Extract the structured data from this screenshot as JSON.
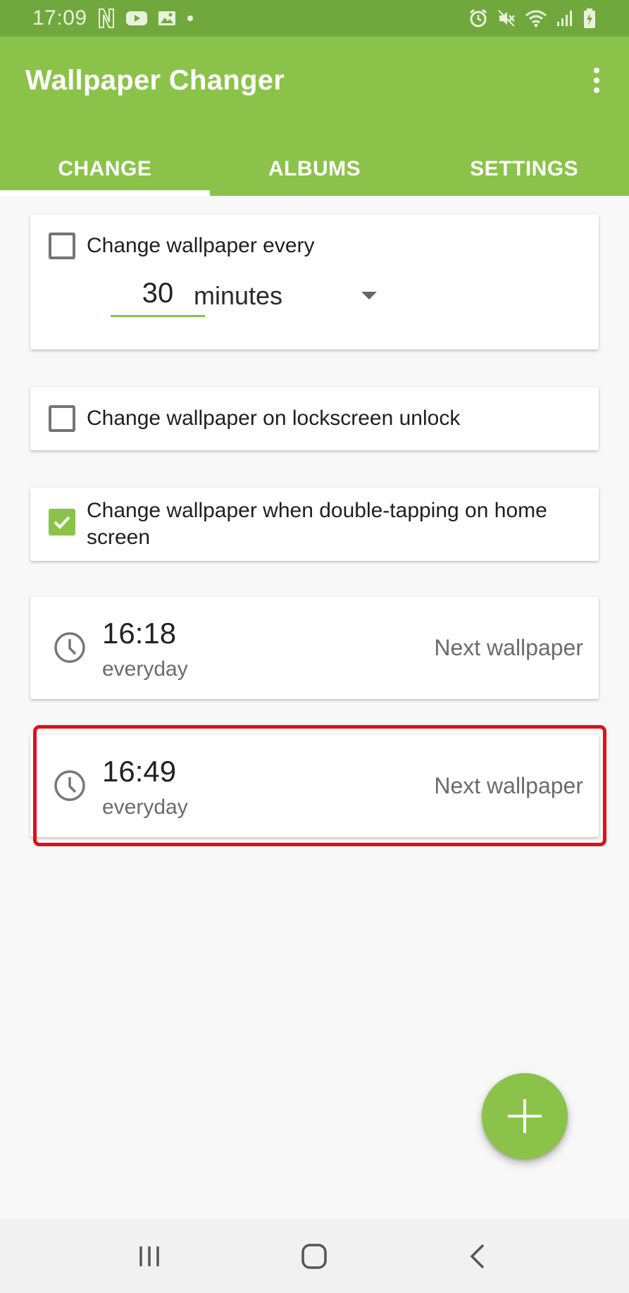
{
  "status_bar": {
    "time": "17:09",
    "left_icons": [
      "netflix-icon",
      "youtube-icon",
      "gallery-icon",
      "dot-icon"
    ],
    "right_icons": [
      "alarm-icon",
      "mute-icon",
      "wifi-icon",
      "signal-icon",
      "battery-charging-icon"
    ]
  },
  "app_bar": {
    "title": "Wallpaper Changer",
    "overflow_icon": "more-vert-icon",
    "background": "#8bc34a"
  },
  "tabs": [
    {
      "label": "CHANGE",
      "active": true
    },
    {
      "label": "ALBUMS",
      "active": false
    },
    {
      "label": "SETTINGS",
      "active": false
    }
  ],
  "interval_card": {
    "checkbox_label": "Change wallpaper every",
    "checked": false,
    "interval_value": "30",
    "unit_selected": "minutes"
  },
  "unlock_card": {
    "checkbox_label": "Change wallpaper on lockscreen unlock",
    "checked": false
  },
  "doubletap_card": {
    "checkbox_label": "Change wallpaper when double-tapping on home screen",
    "checked": true
  },
  "schedules": [
    {
      "time": "16:18",
      "repeat": "everyday",
      "action": "Next wallpaper",
      "icon": "clock-icon"
    },
    {
      "time": "16:49",
      "repeat": "everyday",
      "action": "Next wallpaper",
      "icon": "clock-icon",
      "highlighted": true
    }
  ],
  "fab": {
    "icon": "plus-icon"
  },
  "nav_bar": {
    "buttons": [
      "recents-icon",
      "home-icon",
      "back-icon"
    ]
  },
  "colors": {
    "accent": "#8bc34a",
    "status_bar": "#71a83e",
    "highlight": "#e0101a"
  }
}
